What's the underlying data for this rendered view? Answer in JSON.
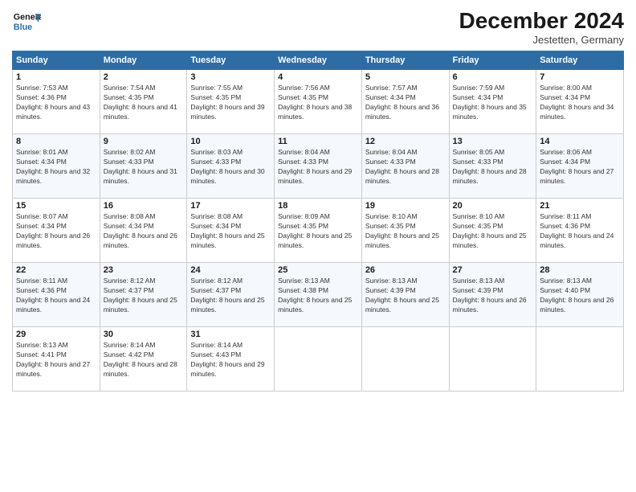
{
  "header": {
    "logo_line1": "General",
    "logo_line2": "Blue",
    "month": "December 2024",
    "location": "Jestetten, Germany"
  },
  "weekdays": [
    "Sunday",
    "Monday",
    "Tuesday",
    "Wednesday",
    "Thursday",
    "Friday",
    "Saturday"
  ],
  "weeks": [
    [
      {
        "day": "1",
        "rise": "7:53 AM",
        "set": "4:36 PM",
        "daylight": "8 hours and 43 minutes."
      },
      {
        "day": "2",
        "rise": "7:54 AM",
        "set": "4:35 PM",
        "daylight": "8 hours and 41 minutes."
      },
      {
        "day": "3",
        "rise": "7:55 AM",
        "set": "4:35 PM",
        "daylight": "8 hours and 39 minutes."
      },
      {
        "day": "4",
        "rise": "7:56 AM",
        "set": "4:35 PM",
        "daylight": "8 hours and 38 minutes."
      },
      {
        "day": "5",
        "rise": "7:57 AM",
        "set": "4:34 PM",
        "daylight": "8 hours and 36 minutes."
      },
      {
        "day": "6",
        "rise": "7:59 AM",
        "set": "4:34 PM",
        "daylight": "8 hours and 35 minutes."
      },
      {
        "day": "7",
        "rise": "8:00 AM",
        "set": "4:34 PM",
        "daylight": "8 hours and 34 minutes."
      }
    ],
    [
      {
        "day": "8",
        "rise": "8:01 AM",
        "set": "4:34 PM",
        "daylight": "8 hours and 32 minutes."
      },
      {
        "day": "9",
        "rise": "8:02 AM",
        "set": "4:33 PM",
        "daylight": "8 hours and 31 minutes."
      },
      {
        "day": "10",
        "rise": "8:03 AM",
        "set": "4:33 PM",
        "daylight": "8 hours and 30 minutes."
      },
      {
        "day": "11",
        "rise": "8:04 AM",
        "set": "4:33 PM",
        "daylight": "8 hours and 29 minutes."
      },
      {
        "day": "12",
        "rise": "8:04 AM",
        "set": "4:33 PM",
        "daylight": "8 hours and 28 minutes."
      },
      {
        "day": "13",
        "rise": "8:05 AM",
        "set": "4:33 PM",
        "daylight": "8 hours and 28 minutes."
      },
      {
        "day": "14",
        "rise": "8:06 AM",
        "set": "4:34 PM",
        "daylight": "8 hours and 27 minutes."
      }
    ],
    [
      {
        "day": "15",
        "rise": "8:07 AM",
        "set": "4:34 PM",
        "daylight": "8 hours and 26 minutes."
      },
      {
        "day": "16",
        "rise": "8:08 AM",
        "set": "4:34 PM",
        "daylight": "8 hours and 26 minutes."
      },
      {
        "day": "17",
        "rise": "8:08 AM",
        "set": "4:34 PM",
        "daylight": "8 hours and 25 minutes."
      },
      {
        "day": "18",
        "rise": "8:09 AM",
        "set": "4:35 PM",
        "daylight": "8 hours and 25 minutes."
      },
      {
        "day": "19",
        "rise": "8:10 AM",
        "set": "4:35 PM",
        "daylight": "8 hours and 25 minutes."
      },
      {
        "day": "20",
        "rise": "8:10 AM",
        "set": "4:35 PM",
        "daylight": "8 hours and 25 minutes."
      },
      {
        "day": "21",
        "rise": "8:11 AM",
        "set": "4:36 PM",
        "daylight": "8 hours and 24 minutes."
      }
    ],
    [
      {
        "day": "22",
        "rise": "8:11 AM",
        "set": "4:36 PM",
        "daylight": "8 hours and 24 minutes."
      },
      {
        "day": "23",
        "rise": "8:12 AM",
        "set": "4:37 PM",
        "daylight": "8 hours and 25 minutes."
      },
      {
        "day": "24",
        "rise": "8:12 AM",
        "set": "4:37 PM",
        "daylight": "8 hours and 25 minutes."
      },
      {
        "day": "25",
        "rise": "8:13 AM",
        "set": "4:38 PM",
        "daylight": "8 hours and 25 minutes."
      },
      {
        "day": "26",
        "rise": "8:13 AM",
        "set": "4:39 PM",
        "daylight": "8 hours and 25 minutes."
      },
      {
        "day": "27",
        "rise": "8:13 AM",
        "set": "4:39 PM",
        "daylight": "8 hours and 26 minutes."
      },
      {
        "day": "28",
        "rise": "8:13 AM",
        "set": "4:40 PM",
        "daylight": "8 hours and 26 minutes."
      }
    ],
    [
      {
        "day": "29",
        "rise": "8:13 AM",
        "set": "4:41 PM",
        "daylight": "8 hours and 27 minutes."
      },
      {
        "day": "30",
        "rise": "8:14 AM",
        "set": "4:42 PM",
        "daylight": "8 hours and 28 minutes."
      },
      {
        "day": "31",
        "rise": "8:14 AM",
        "set": "4:43 PM",
        "daylight": "8 hours and 29 minutes."
      },
      null,
      null,
      null,
      null
    ]
  ]
}
